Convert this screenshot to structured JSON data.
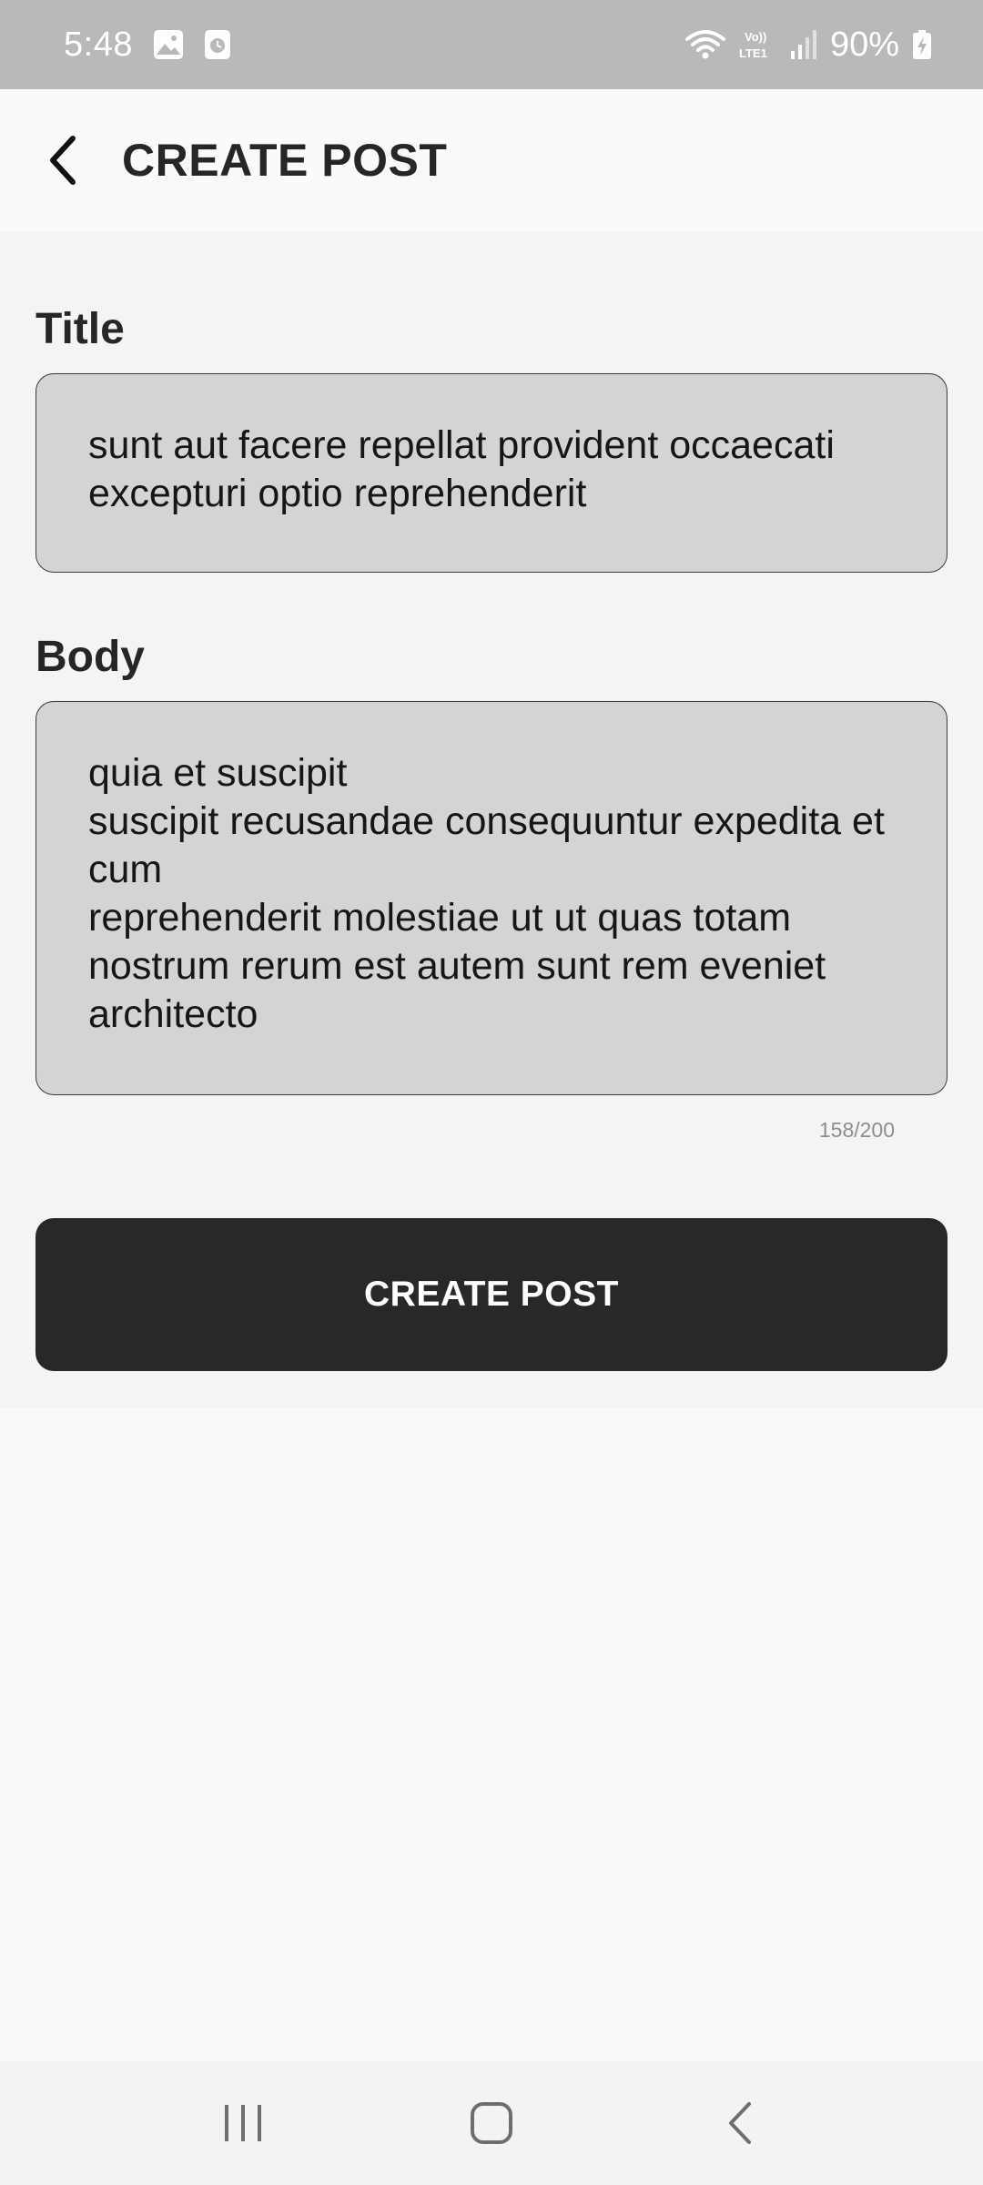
{
  "status_bar": {
    "time": "5:48",
    "battery": "90%",
    "network_label": "Vo)) LTE1",
    "icons": [
      "image-icon",
      "clock-app-icon",
      "wifi-icon",
      "lte-icon",
      "signal-icon",
      "battery-charging-icon"
    ]
  },
  "app_bar": {
    "title": "CREATE POST",
    "back_icon": "chevron-left-icon"
  },
  "form": {
    "title_label": "Title",
    "title_value": "sunt aut facere repellat provident occaecati\nexcepturi optio reprehenderit",
    "body_label": "Body",
    "body_value": "quia et suscipit\nsuscipit recusandae consequuntur expedita et cum\nreprehenderit molestiae ut ut quas totam\nnostrum rerum est autem sunt rem eveniet\narchitecto",
    "char_counter": "158/200",
    "submit_label": "CREATE POST"
  },
  "nav_bar": {
    "icons": [
      "recent-apps-icon",
      "home-icon",
      "back-icon"
    ]
  },
  "colors": {
    "status_bar_bg": "#b9b9b9",
    "app_bar_bg": "#fafafa",
    "form_bg": "#f4f4f4",
    "input_bg": "#d4d4d4",
    "button_bg": "#282828",
    "text_dark": "#262626"
  }
}
